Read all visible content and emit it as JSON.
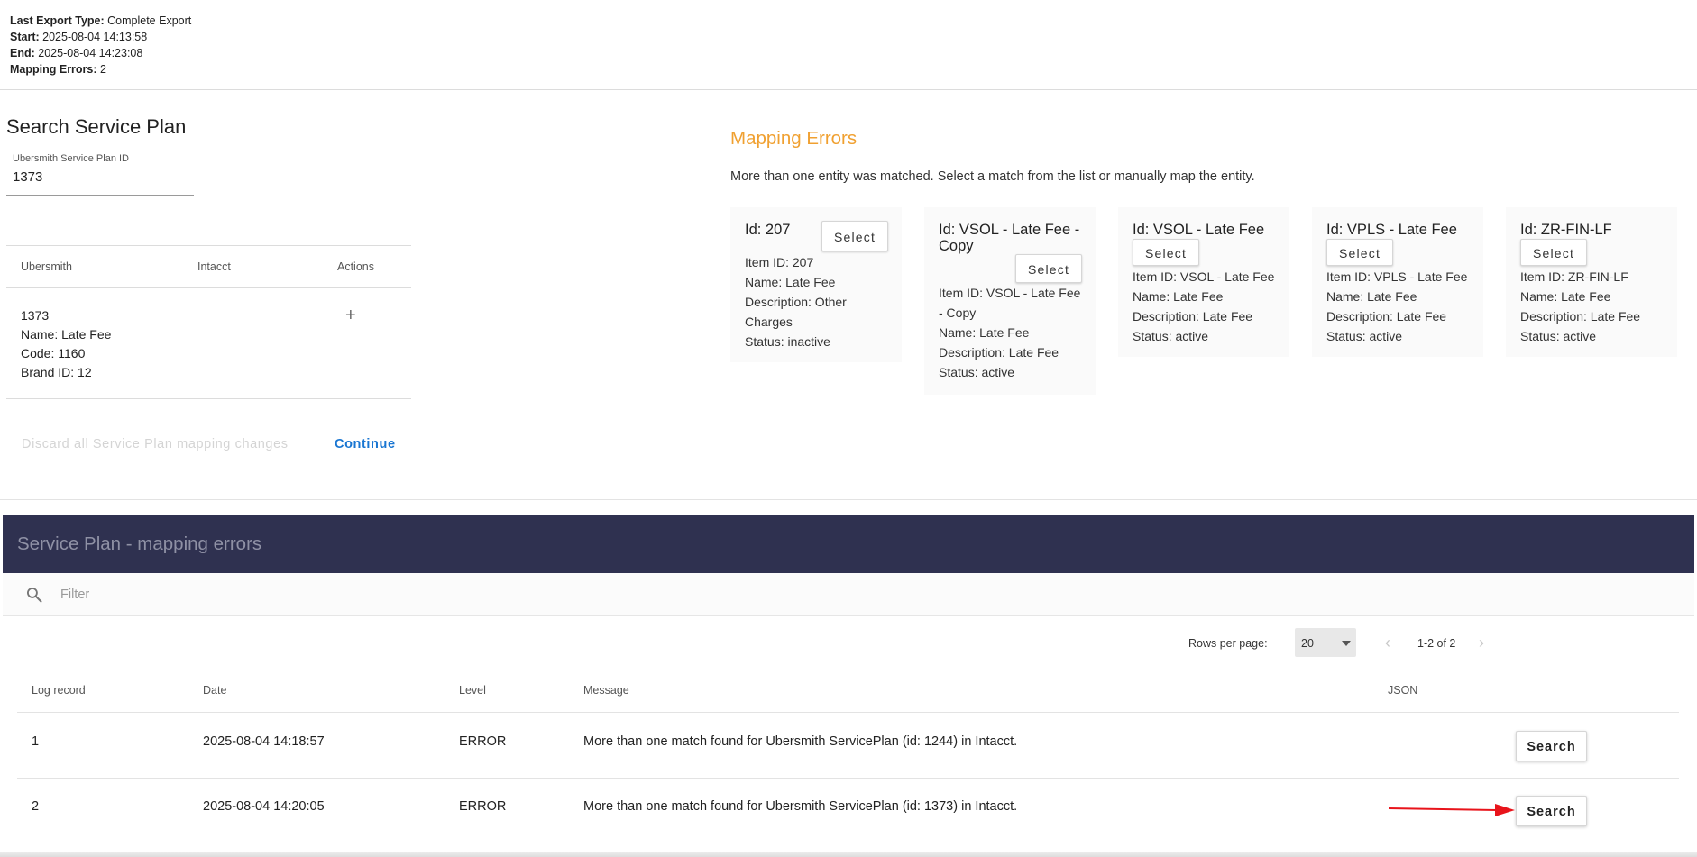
{
  "export_info": {
    "type_label": "Last Export Type:",
    "type_value": "Complete Export",
    "start_label": "Start:",
    "start_value": "2025-08-04 14:13:58",
    "end_label": "End:",
    "end_value": "2025-08-04 14:23:08",
    "errors_label": "Mapping Errors:",
    "errors_value": "2"
  },
  "search_panel": {
    "title": "Search Service Plan",
    "field_label": "Ubersmith Service Plan ID",
    "field_value": "1373",
    "columns": [
      "Ubersmith",
      "Intacct",
      "Actions"
    ],
    "row": {
      "id": "1373",
      "name": "Name: Late Fee",
      "code": "Code: 1160",
      "brand": "Brand ID: 12",
      "action_icon": "+"
    },
    "discard_label": "Discard all Service Plan mapping changes",
    "continue_label": "Continue"
  },
  "mapping_errors": {
    "title": "Mapping Errors",
    "description": "More than one entity was matched. Select a match from the list or manually map the entity.",
    "select_label": "Select",
    "cards": [
      {
        "title": "Id: 207",
        "lines": [
          "Item ID: 207",
          "Name: Late Fee",
          "Description: Other",
          "Charges",
          "Status: inactive"
        ]
      },
      {
        "title_lines": [
          "Id: VSOL - Late Fee -",
          "Copy"
        ],
        "lines": [
          "Item ID: VSOL - Late Fee",
          "- Copy",
          "Name: Late Fee",
          "Description: Late Fee",
          "Status: active"
        ]
      },
      {
        "title": "Id: VSOL - Late Fee",
        "lines": [
          "Item ID: VSOL - Late Fee",
          "Name: Late Fee",
          "Description: Late Fee",
          "Status: active"
        ]
      },
      {
        "title": "Id: VPLS - Late Fee",
        "lines": [
          "Item ID: VPLS - Late Fee",
          "Name: Late Fee",
          "Description: Late Fee",
          "Status: active"
        ]
      },
      {
        "title": "Id: ZR-FIN-LF",
        "lines": [
          "Item ID: ZR-FIN-LF",
          "Name: Late Fee",
          "Description: Late Fee",
          "Status: active"
        ]
      }
    ]
  },
  "grid": {
    "title": "Service Plan - mapping errors",
    "filter_placeholder": "Filter",
    "rows_per_page_label": "Rows per page:",
    "rows_per_page_value": "20",
    "page_range": "1-2 of 2",
    "prev_icon": "‹",
    "next_icon": "›",
    "columns": [
      "Log record",
      "Date",
      "Level",
      "Message",
      "JSON"
    ],
    "rows": [
      {
        "record": "1",
        "date": "2025-08-04 14:18:57",
        "level": "ERROR",
        "message": "More than one match found for Ubersmith ServicePlan (id: 1244) in Intacct.",
        "button": "Search"
      },
      {
        "record": "2",
        "date": "2025-08-04 14:20:05",
        "level": "ERROR",
        "message": "More than one match found for Ubersmith ServicePlan (id: 1373) in Intacct.",
        "button": "Search"
      }
    ]
  },
  "colors": {
    "header_bg": "#2f3150",
    "mapping_title": "#f0a030",
    "continue": "#1976d2",
    "annotation_arrow": "#e8141b"
  }
}
